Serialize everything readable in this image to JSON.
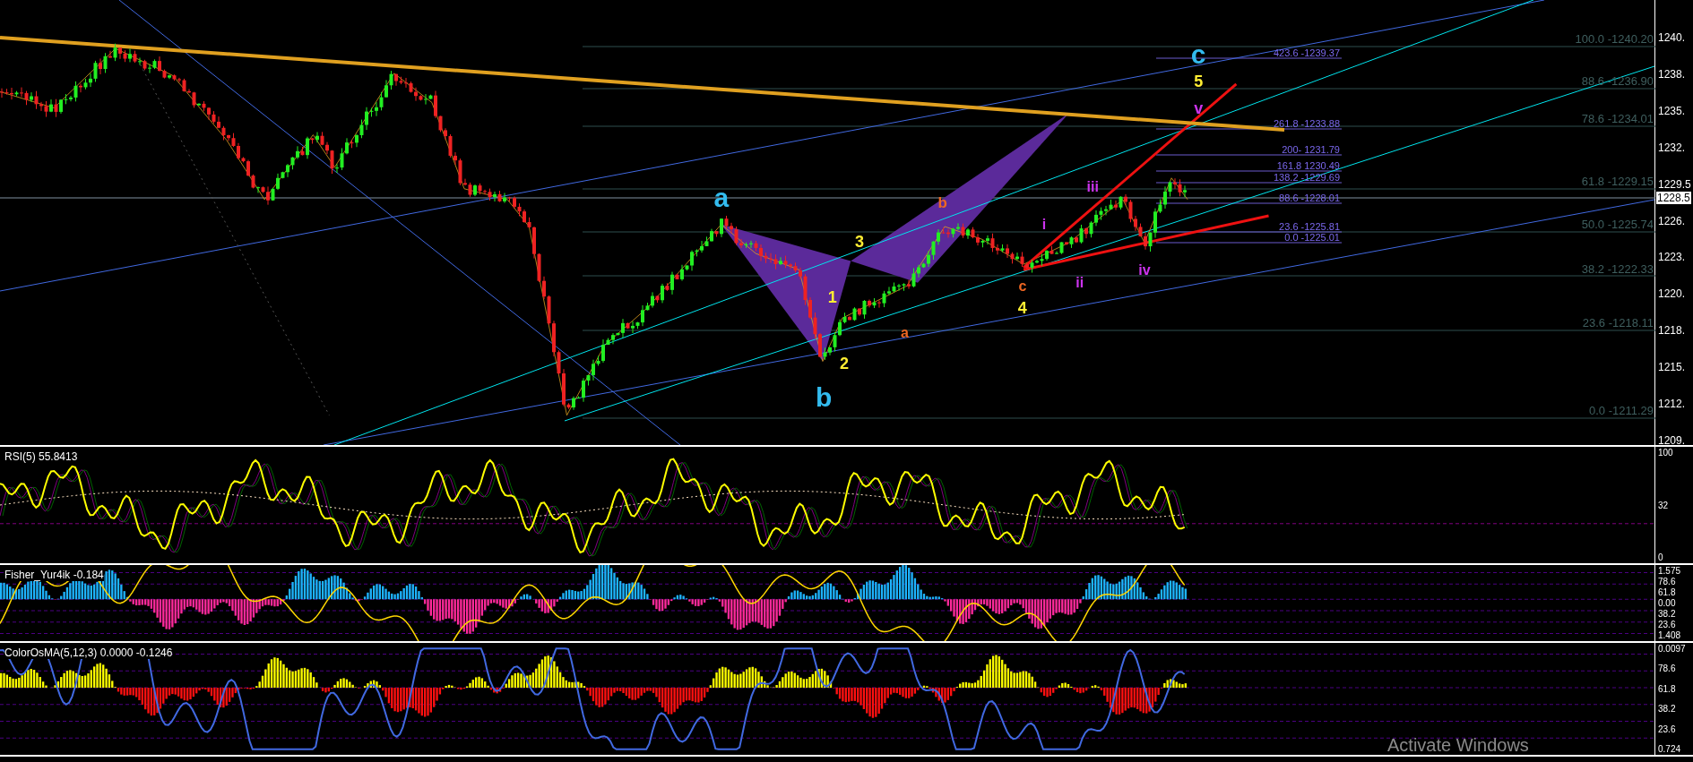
{
  "price_chart": {
    "axis_labels": [
      "1240.",
      "1238.",
      "1235.",
      "1232.",
      "1229.5",
      "1226.",
      "1223.",
      "1220.",
      "1218.",
      "1215.",
      "1212.",
      "1209."
    ],
    "current_price": "1228.5",
    "fib_retracement_labels": [
      "100.0 -1240.20",
      "88.6 -1236.90",
      "78.6 -1234.01",
      "61.8 -1229.15",
      "50.0 -1225.74",
      "38.2 -1222.33",
      "23.6 -1218.11",
      "0.0 -1211.29"
    ],
    "fib_extension_labels": [
      "423.6 -1239.37",
      "261.8 -1233.88",
      "200- 1231.79",
      "161.8 1230.49",
      "138.2  -1229.69",
      "88.6 -1228.01",
      "23.6 -1225.81",
      "0.0 -1225.01"
    ],
    "wave_labels": [
      {
        "text": "a",
        "color": "#33bbee"
      },
      {
        "text": "b",
        "color": "#33bbee"
      },
      {
        "text": "c",
        "color": "#33bbee"
      },
      {
        "text": "5",
        "color": "#ffee33"
      },
      {
        "text": "v",
        "color": "#cc33ee"
      },
      {
        "text": "b",
        "color": "#ee6622"
      },
      {
        "text": "3",
        "color": "#ffee33"
      },
      {
        "text": "1",
        "color": "#ffee33"
      },
      {
        "text": "2",
        "color": "#ffee33"
      },
      {
        "text": "a",
        "color": "#ee6622"
      },
      {
        "text": "c",
        "color": "#ee6622"
      },
      {
        "text": "4",
        "color": "#ffee33"
      },
      {
        "text": "i",
        "color": "#cc33ee"
      },
      {
        "text": "ii",
        "color": "#cc33ee"
      },
      {
        "text": "iii",
        "color": "#cc33ee"
      },
      {
        "text": "iv",
        "color": "#cc33ee"
      }
    ]
  },
  "indicators": [
    {
      "kind": "rsi",
      "title": "RSI(5) 55.8413",
      "axis_labels": [
        "100",
        "32",
        "0"
      ]
    },
    {
      "kind": "fisher",
      "title": "Fisher_Yur4ik -0.184",
      "axis_labels": [
        "1.575",
        "78.6",
        "61.8",
        "0.00",
        "38.2",
        "23.6",
        "1.408"
      ]
    },
    {
      "kind": "osma",
      "title": "ColorOsMA(5,12,3) 0.0000 -0.1246",
      "axis_labels": [
        "0.0097",
        "78.6",
        "61.8",
        "38.2",
        "23.6",
        "0.724"
      ]
    }
  ],
  "activation_notice": "Activate Windows"
}
